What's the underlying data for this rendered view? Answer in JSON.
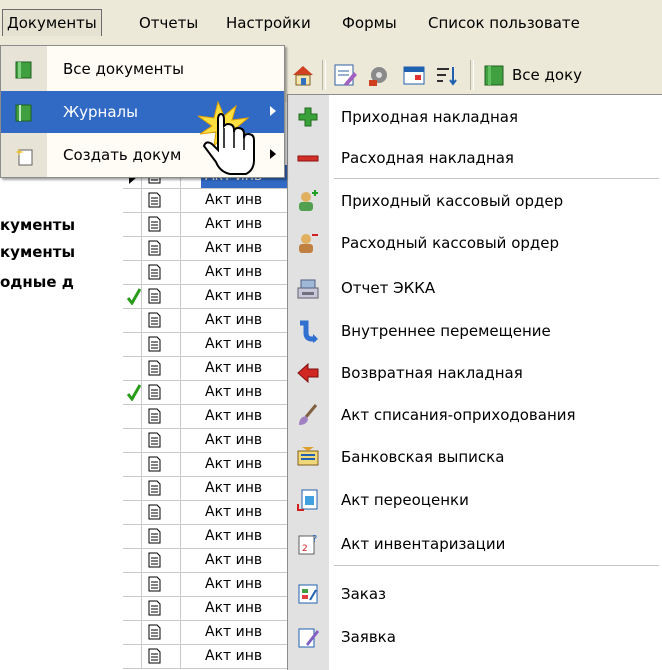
{
  "menubar": {
    "items": [
      "Документы",
      "Отчеты",
      "Настройки",
      "Формы",
      "Список пользовате"
    ]
  },
  "toolbar": {
    "all_docs_label": "Все доку"
  },
  "tree": {
    "nodes": [
      "кументы",
      "кументы",
      "одные д"
    ]
  },
  "grid": {
    "cell_text": "Акт инв",
    "rows": [
      {
        "marker": "arrow",
        "text": "Акт инв",
        "selected": true
      },
      {
        "marker": "",
        "text": "Акт инв"
      },
      {
        "marker": "",
        "text": "Акт инв"
      },
      {
        "marker": "",
        "text": "Акт инв"
      },
      {
        "marker": "",
        "text": "Акт инв"
      },
      {
        "marker": "check",
        "text": "Акт инв"
      },
      {
        "marker": "",
        "text": "Акт инв"
      },
      {
        "marker": "",
        "text": "Акт инв"
      },
      {
        "marker": "",
        "text": "Акт инв"
      },
      {
        "marker": "check",
        "text": "Акт инв"
      },
      {
        "marker": "",
        "text": "Акт инв"
      },
      {
        "marker": "",
        "text": "Акт инв"
      },
      {
        "marker": "",
        "text": "Акт инв"
      },
      {
        "marker": "",
        "text": "Акт инв"
      },
      {
        "marker": "",
        "text": "Акт инв"
      },
      {
        "marker": "",
        "text": "Акт инв"
      },
      {
        "marker": "",
        "text": "Акт инв"
      },
      {
        "marker": "",
        "text": "Акт инв"
      },
      {
        "marker": "",
        "text": "Акт инв"
      },
      {
        "marker": "",
        "text": "Акт инв"
      },
      {
        "marker": "",
        "text": "Акт инв"
      }
    ]
  },
  "menu1": {
    "items": [
      {
        "label": "Все документы",
        "icon": "ledger-icon",
        "submenu": false
      },
      {
        "label": "Журналы",
        "icon": "journal-icon",
        "submenu": true,
        "highlighted": true
      },
      {
        "label": "Создать докум",
        "icon": "new-document-icon",
        "submenu": true
      }
    ]
  },
  "menu2": {
    "items": [
      {
        "label": "Приходная накладная",
        "icon": "plus-icon"
      },
      {
        "label": "Расходная накладная",
        "icon": "minus-icon"
      },
      {
        "label": "Приходный кассовый ордер",
        "icon": "cash-in-icon"
      },
      {
        "label": "Расходный кассовый ордер",
        "icon": "cash-out-icon"
      },
      {
        "label": "Отчет ЭККА",
        "icon": "cash-register-icon"
      },
      {
        "label": "Внутреннее перемещение",
        "icon": "transfer-icon"
      },
      {
        "label": "Возвратная накладная",
        "icon": "return-arrow-icon"
      },
      {
        "label": "Акт списания-оприходования",
        "icon": "brush-icon"
      },
      {
        "label": "Банковская выписка",
        "icon": "bank-statement-icon"
      },
      {
        "label": "Акт переоценки",
        "icon": "revaluation-icon"
      },
      {
        "label": "Акт инвентаризации",
        "icon": "inventory-icon"
      },
      {
        "label": "Заказ",
        "icon": "order-icon"
      },
      {
        "label": "Заявка",
        "icon": "request-icon"
      }
    ]
  },
  "colors": {
    "highlight": "#316ac5",
    "menubar_bg": "#ece9d8",
    "check_green": "#2a9a1a"
  }
}
